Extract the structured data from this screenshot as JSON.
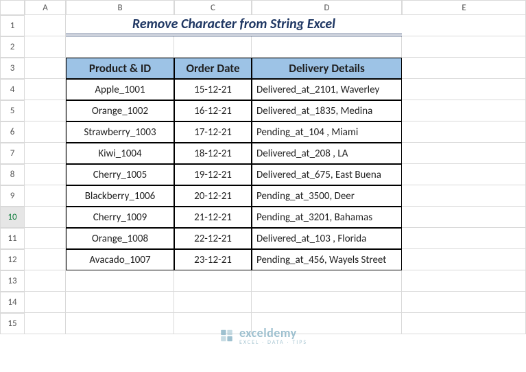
{
  "columns": [
    "A",
    "B",
    "C",
    "D",
    "E"
  ],
  "rows": [
    "1",
    "2",
    "3",
    "4",
    "5",
    "6",
    "7",
    "8",
    "9",
    "10",
    "11",
    "12",
    "13",
    "14",
    "15"
  ],
  "active_row_index": 9,
  "title": "Remove Character from String Excel",
  "headers": {
    "product": "Product & ID",
    "order": "Order Date",
    "delivery": "Delivery Details"
  },
  "data_rows": [
    {
      "product": "Apple_1001",
      "order": "15-12-21",
      "delivery": "Delivered_at_2101, Waverley"
    },
    {
      "product": "Orange_1002",
      "order": "16-12-21",
      "delivery": "Delivered_at_1835, Medina"
    },
    {
      "product": "Strawberry_1003",
      "order": "17-12-21",
      "delivery": "Pending_at_104 , Miami"
    },
    {
      "product": "Kiwi_1004",
      "order": "18-12-21",
      "delivery": "Delivered_at_208 , LA"
    },
    {
      "product": "Cherry_1005",
      "order": "19-12-21",
      "delivery": "Delivered_at_675, East Buena"
    },
    {
      "product": "Blackberry_1006",
      "order": "20-12-21",
      "delivery": "Pending_at_3500, Deer"
    },
    {
      "product": "Cherry_1009",
      "order": "21-12-21",
      "delivery": "Pending_at_3201, Bahamas"
    },
    {
      "product": "Orange_1008",
      "order": "22-12-21",
      "delivery": "Delivered_at_103 , Florida"
    },
    {
      "product": "Avacado_1007",
      "order": "23-12-21",
      "delivery": "Pending_at_456, Wayels Street"
    }
  ],
  "watermark": {
    "brand": "exceldemy",
    "tag": "EXCEL · DATA · TIPS"
  }
}
